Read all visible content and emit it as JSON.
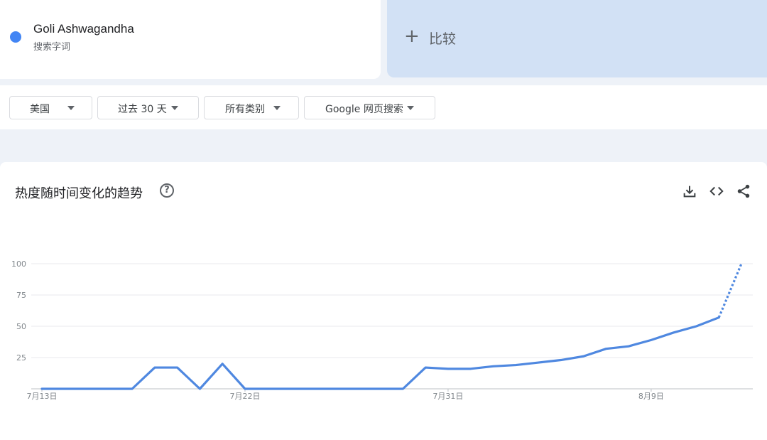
{
  "search_term": {
    "name": "Goli Ashwagandha",
    "type": "搜索字词",
    "color": "#4285f4"
  },
  "compare": {
    "icon": "plus-icon",
    "plus": "+",
    "label": "比较"
  },
  "filters": [
    {
      "label": "美国",
      "icon": "caret-down-icon"
    },
    {
      "label": "过去 30 天",
      "icon": "caret-down-icon"
    },
    {
      "label": "所有类别",
      "icon": "caret-down-icon"
    },
    {
      "label": "Google 网页搜索",
      "icon": "caret-down-icon"
    }
  ],
  "chart_card": {
    "title": "热度随时间变化的趋势",
    "help_icon": "help-icon",
    "help_glyph": "?",
    "toolbar": [
      "download-icon",
      "embed-icon",
      "share-icon"
    ]
  },
  "chart_data": {
    "type": "line",
    "title": "",
    "xlabel": "",
    "ylabel": "",
    "ylim": [
      0,
      100
    ],
    "yticks": [
      0,
      25,
      50,
      75,
      100
    ],
    "ytick_labels": [
      "",
      "25",
      "50",
      "75",
      "100"
    ],
    "x_tick_labels": [
      {
        "index": 0,
        "label": "7月13日"
      },
      {
        "index": 9,
        "label": "7月22日"
      },
      {
        "index": 18,
        "label": "7月31日"
      },
      {
        "index": 27,
        "label": "8月9日"
      }
    ],
    "grid": true,
    "series": [
      {
        "color": "#4f88e0",
        "values": [
          0,
          0,
          0,
          0,
          0,
          17,
          17,
          0,
          20,
          0,
          0,
          0,
          0,
          0,
          0,
          0,
          0,
          17,
          16,
          16,
          18,
          19,
          21,
          23,
          26,
          32,
          34,
          39,
          45,
          50,
          57,
          100
        ],
        "partial_from_index": 30
      }
    ]
  }
}
